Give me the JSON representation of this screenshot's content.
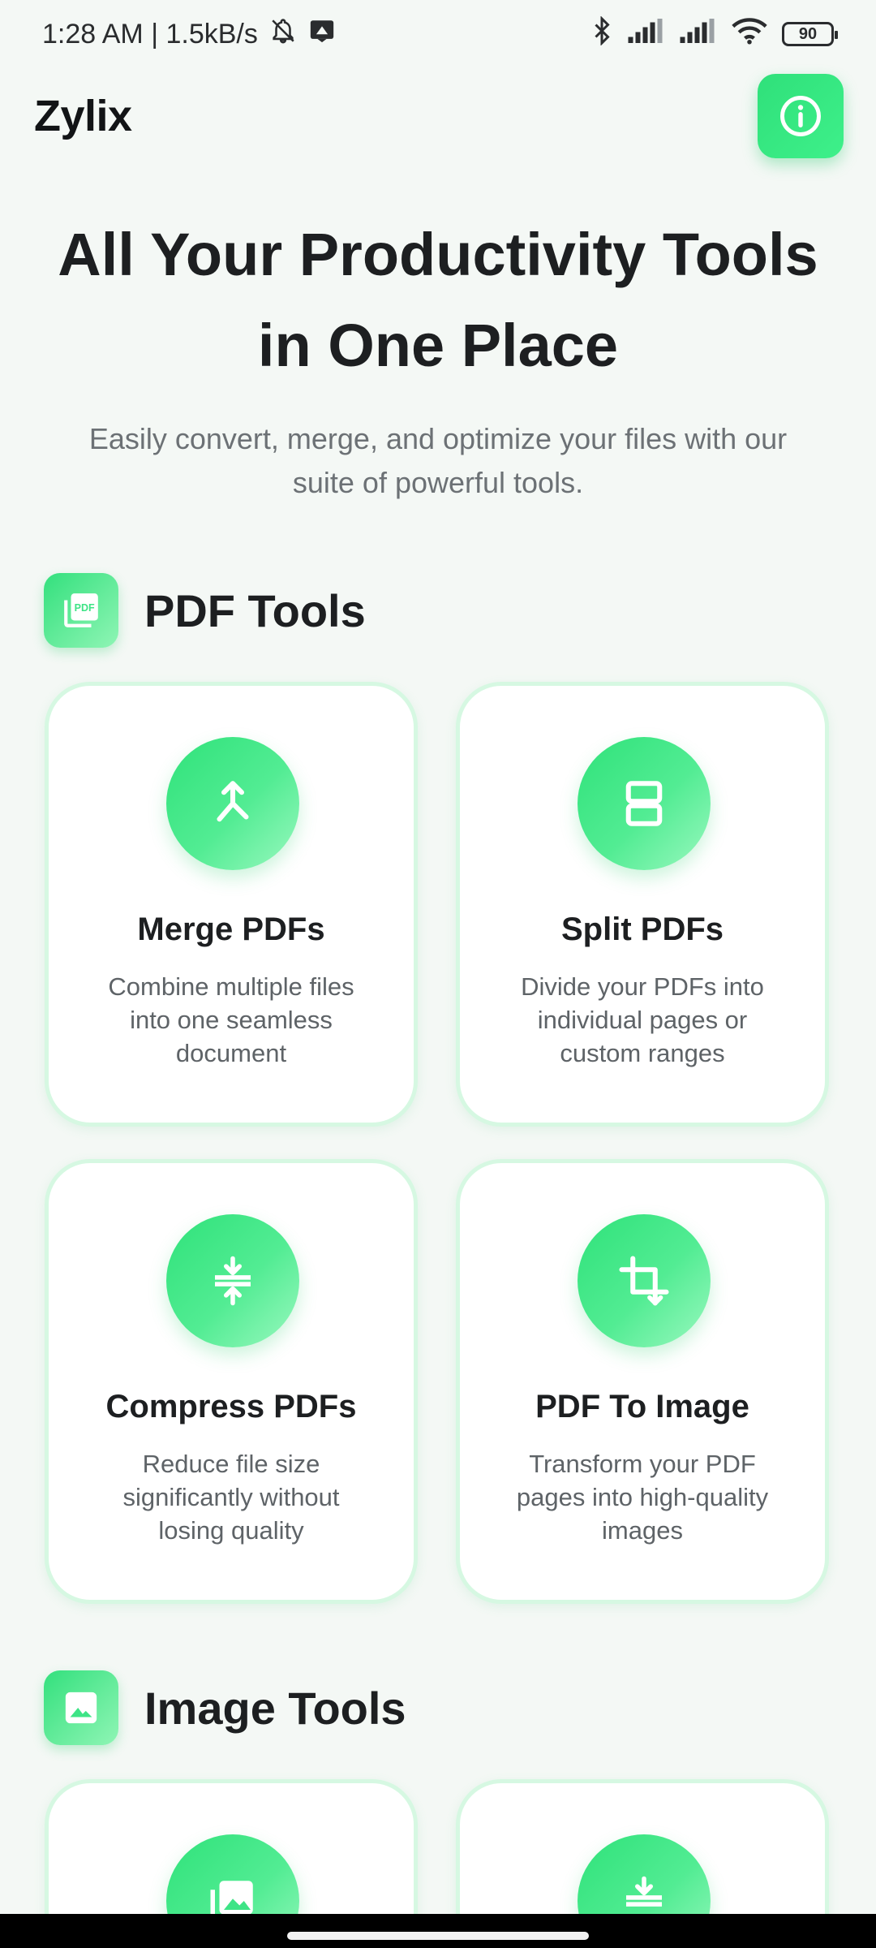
{
  "status_bar": {
    "time_and_speed": "1:28 AM | 1.5kB/s",
    "battery": "90"
  },
  "header": {
    "brand": "Zylix"
  },
  "hero": {
    "title_line1": "All Your Productivity Tools",
    "title_line2": "in One Place",
    "subtitle_line1": "Easily convert, merge, and optimize your files with our",
    "subtitle_line2": "suite of powerful tools."
  },
  "pdf_section": {
    "title": "PDF Tools",
    "icon_text": "PDF",
    "cards": [
      {
        "title": "Merge PDFs",
        "desc": [
          "Combine multiple files",
          "into one seamless",
          "document"
        ]
      },
      {
        "title": "Split PDFs",
        "desc": [
          "Divide your PDFs into",
          "individual pages or",
          "custom ranges"
        ]
      },
      {
        "title": "Compress PDFs",
        "desc": [
          "Reduce file size",
          "significantly without",
          "losing quality"
        ]
      },
      {
        "title": "PDF To Image",
        "desc": [
          "Transform your PDF",
          "pages into high-quality",
          "images"
        ]
      }
    ]
  },
  "image_section": {
    "title": "Image Tools"
  },
  "colors": {
    "accent": "#2fe07a",
    "accent_light": "#9af8bf",
    "card_border": "#d6f8e2",
    "background": "#f4f8f5"
  },
  "icons": {
    "info": "info-icon",
    "pdf_section": "pdf-files-icon",
    "merge": "merge-icon",
    "split": "split-icon",
    "compress": "compress-icon",
    "pdf_to_image": "crop-icon",
    "image_section": "image-icon"
  }
}
